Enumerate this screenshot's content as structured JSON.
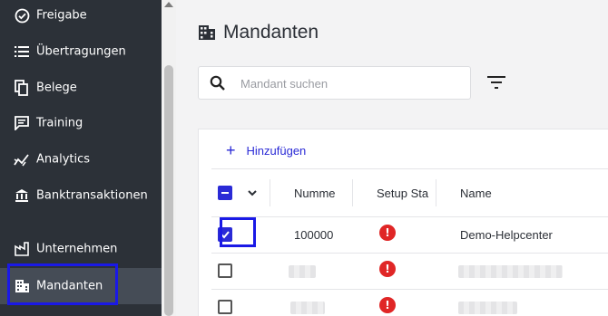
{
  "sidebar": {
    "items": [
      {
        "label": "Freigabe",
        "icon": "check-circle-icon"
      },
      {
        "label": "Übertragungen",
        "icon": "list-icon"
      },
      {
        "label": "Belege",
        "icon": "documents-icon"
      },
      {
        "label": "Training",
        "icon": "chat-icon"
      },
      {
        "label": "Analytics",
        "icon": "analytics-icon"
      },
      {
        "label": "Banktransaktionen",
        "icon": "bank-icon"
      },
      {
        "label": "Unternehmen",
        "icon": "company-icon"
      },
      {
        "label": "Mandanten",
        "icon": "building-icon",
        "active": true
      }
    ]
  },
  "main": {
    "title": "Mandanten",
    "search": {
      "placeholder": "Mandant suchen",
      "value": ""
    },
    "add_label": "Hinzufügen",
    "columns": [
      "Numme",
      "Setup Sta",
      "Name"
    ],
    "rows": [
      {
        "number": "100000",
        "status": "!",
        "name": "Demo-Helpcenter",
        "checked": true
      },
      {
        "number": "",
        "status": "!",
        "name": "",
        "checked": false,
        "redacted": true
      },
      {
        "number": "",
        "status": "!",
        "name": "",
        "checked": false,
        "redacted": true
      }
    ]
  },
  "colors": {
    "accent": "#2a2ad6",
    "sidebar": "#2c3138",
    "warning": "#e02626",
    "highlight": "#1a19e6"
  }
}
